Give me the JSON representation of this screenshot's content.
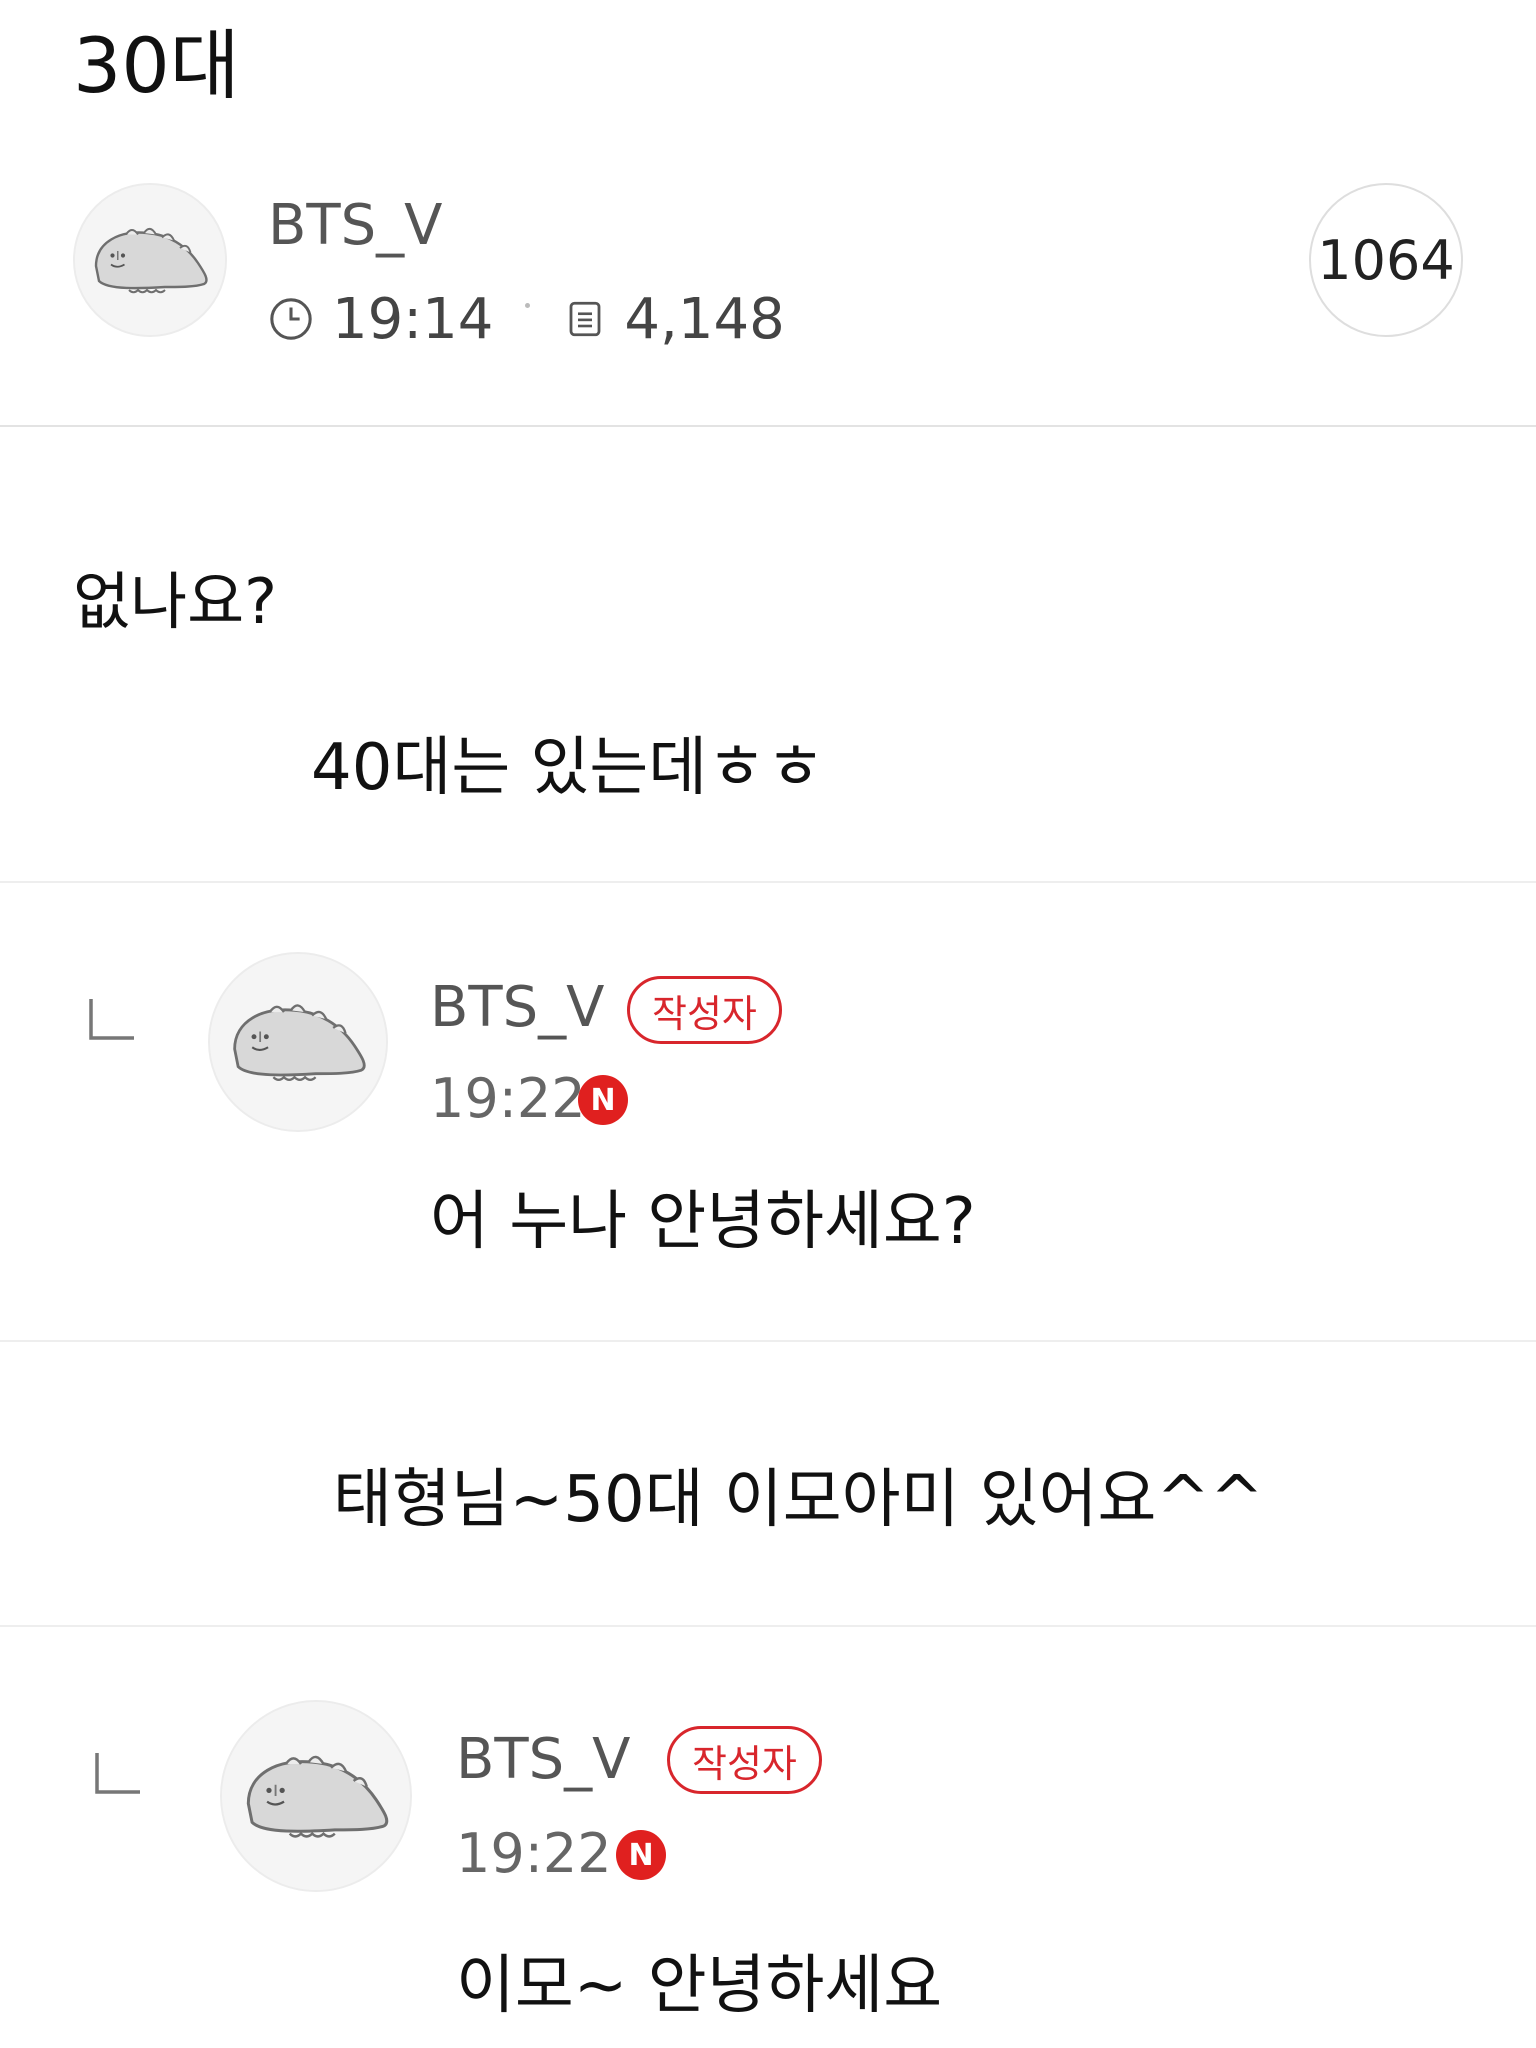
{
  "post": {
    "title": "30대",
    "author": "BTS_V",
    "time": "19:14",
    "views": "4,148",
    "comment_count": "1064",
    "body": "없나요?"
  },
  "comments": [
    {
      "text": "40대는 있는데ㅎㅎ"
    },
    {
      "author": "BTS_V",
      "badge": "작성자",
      "time": "19:22",
      "new_badge": "N",
      "text": "어 누나 안녕하세요?"
    },
    {
      "text": "태형님~50대 이모아미 있어요^^"
    },
    {
      "author": "BTS_V",
      "badge": "작성자",
      "time": "19:22",
      "new_badge": "N",
      "text": "이모~ 안녕하세요"
    }
  ],
  "icons": {
    "avatar": "dinosaur-character-avatar",
    "clock": "clock-icon",
    "views": "document-icon",
    "reply": "reply-indent-icon"
  },
  "colors": {
    "accent_red": "#d8262c",
    "new_badge": "#e0201f"
  }
}
